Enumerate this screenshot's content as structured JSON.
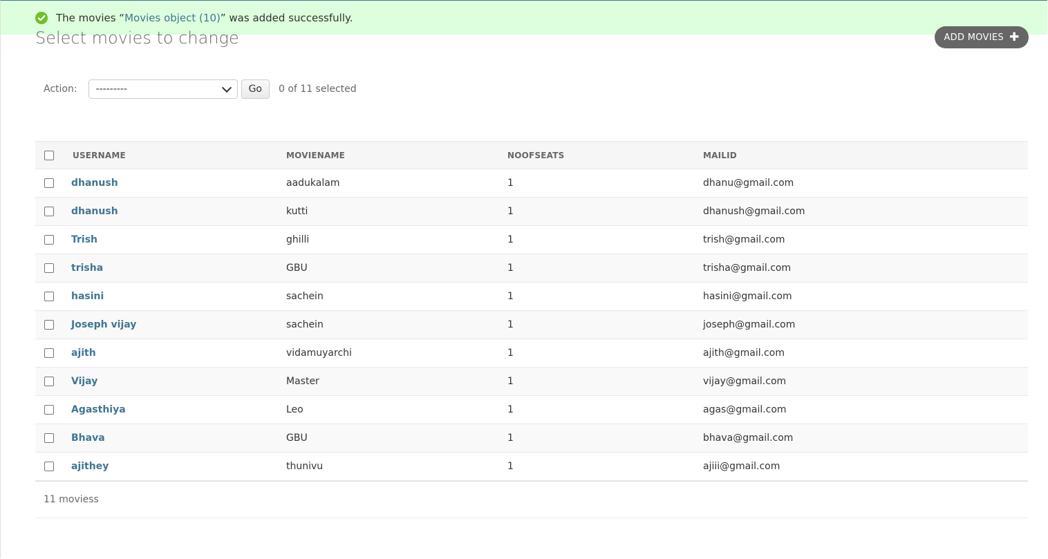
{
  "message": {
    "prefix": "The movies “",
    "link_text": "Movies object (10)",
    "suffix": "” was added successfully.",
    "icon": "check-circle-icon"
  },
  "page_title": "Select movies to change",
  "add_button": {
    "label": "ADD MOVIES",
    "icon": "plus-icon"
  },
  "actions": {
    "label": "Action:",
    "selected_value": "---------",
    "go_label": "Go",
    "selected_count": "0 of 11 selected"
  },
  "table": {
    "headers": [
      "USERNAME",
      "MOVIENAME",
      "NOOFSEATS",
      "MAILID"
    ],
    "rows": [
      {
        "username": "dhanush",
        "moviename": "aadukalam",
        "noofseats": "1",
        "mailid": "dhanu@gmail.com"
      },
      {
        "username": "dhanush",
        "moviename": "kutti",
        "noofseats": "1",
        "mailid": "dhanush@gmail.com"
      },
      {
        "username": "Trish",
        "moviename": "ghilli",
        "noofseats": "1",
        "mailid": "trish@gmail.com"
      },
      {
        "username": "trisha",
        "moviename": "GBU",
        "noofseats": "1",
        "mailid": "trisha@gmail.com"
      },
      {
        "username": "hasini",
        "moviename": "sachein",
        "noofseats": "1",
        "mailid": "hasini@gmail.com"
      },
      {
        "username": "Joseph vijay",
        "moviename": "sachein",
        "noofseats": "1",
        "mailid": "joseph@gmail.com"
      },
      {
        "username": "ajith",
        "moviename": "vidamuyarchi",
        "noofseats": "1",
        "mailid": "ajith@gmail.com"
      },
      {
        "username": "Vijay",
        "moviename": "Master",
        "noofseats": "1",
        "mailid": "vijay@gmail.com"
      },
      {
        "username": "Agasthiya",
        "moviename": "Leo",
        "noofseats": "1",
        "mailid": "agas@gmail.com"
      },
      {
        "username": "Bhava",
        "moviename": "GBU",
        "noofseats": "1",
        "mailid": "bhava@gmail.com"
      },
      {
        "username": "ajithey",
        "moviename": "thunivu",
        "noofseats": "1",
        "mailid": "ajiii@gmail.com"
      }
    ]
  },
  "paginator": "11 moviess",
  "colors": {
    "message_bg": "#ddffdd",
    "success_icon": "#70bf2b",
    "link": "#417690",
    "add_button_bg": "#666666"
  }
}
